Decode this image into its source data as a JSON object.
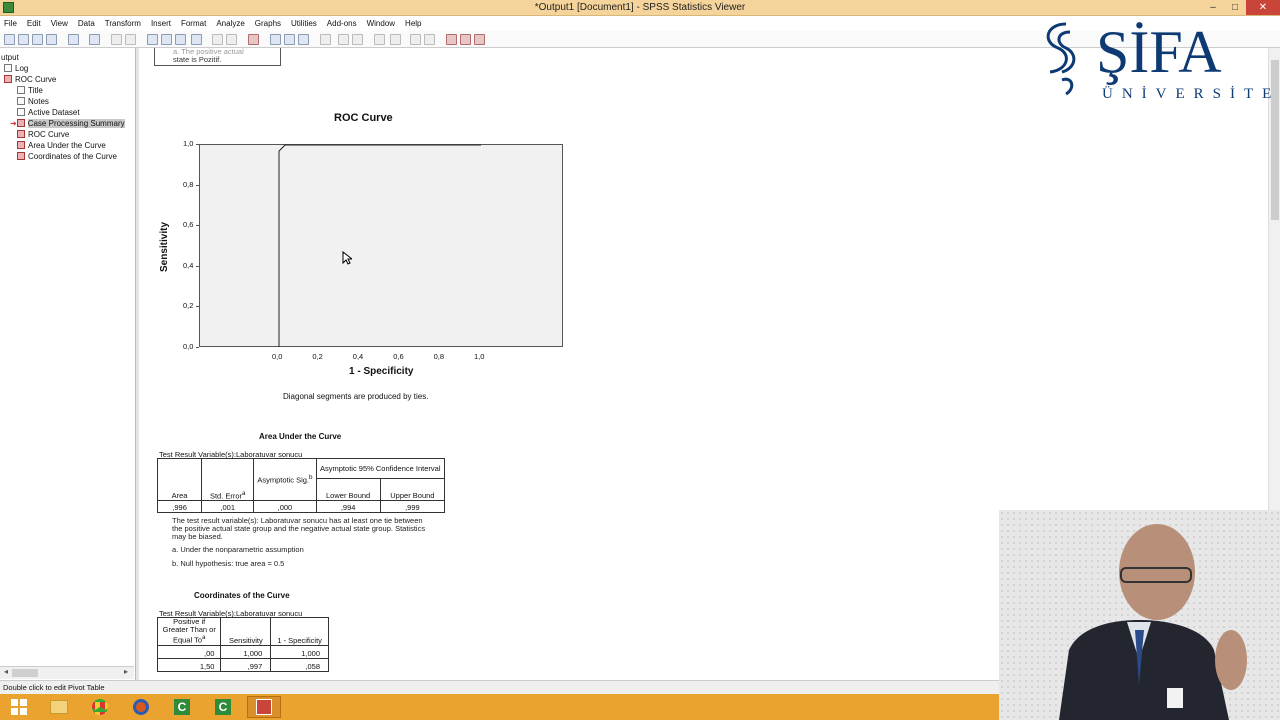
{
  "window": {
    "title": "*Output1 [Document1] - SPSS Statistics Viewer",
    "minimize": "–",
    "maximize": "□",
    "close": "✕"
  },
  "menu": [
    "File",
    "Edit",
    "View",
    "Data",
    "Transform",
    "Insert",
    "Format",
    "Analyze",
    "Graphs",
    "Utilities",
    "Add-ons",
    "Window",
    "Help"
  ],
  "outline": {
    "items": [
      {
        "label": "utput",
        "icon": "none",
        "selected": false
      },
      {
        "label": "Log",
        "icon": "log-icon",
        "selected": false
      },
      {
        "label": "ROC Curve",
        "icon": "folder-icon",
        "selected": false
      },
      {
        "label": "Title",
        "icon": "doc-icon",
        "selected": false
      },
      {
        "label": "Notes",
        "icon": "doc-icon",
        "selected": false
      },
      {
        "label": "Active Dataset",
        "icon": "doc-icon",
        "selected": false
      },
      {
        "label": "Case Processing Summary",
        "icon": "table-icon",
        "selected": true
      },
      {
        "label": "ROC Curve",
        "icon": "chart-icon",
        "selected": false
      },
      {
        "label": "Area Under the Curve",
        "icon": "table-icon",
        "selected": false
      },
      {
        "label": "Coordinates of the Curve",
        "icon": "table-icon",
        "selected": false
      }
    ]
  },
  "content": {
    "note_fragment": [
      "a. The positive actual",
      "state is Pozitif."
    ],
    "roc_chart": {
      "chart_data": {
        "type": "line",
        "title": "ROC Curve",
        "xlabel": "1 - Specificity",
        "ylabel": "Sensitivity",
        "x_ticks": [
          "0,0",
          "0,2",
          "0,4",
          "0,6",
          "0,8",
          "1,0"
        ],
        "y_ticks": [
          "0,0",
          "0,2",
          "0,4",
          "0,6",
          "0,8",
          "1,0"
        ],
        "xlim": [
          0,
          1
        ],
        "ylim": [
          0,
          1
        ],
        "series": [
          {
            "x": [
              0.0,
              0.0,
              0.03,
              1.0
            ],
            "y": [
              0.0,
              0.97,
              1.0,
              1.0
            ]
          }
        ],
        "grid": false
      },
      "note": "Diagonal segments are produced by ties."
    },
    "auc_table": {
      "title": "Area Under the Curve",
      "variable": "Test Result Variable(s):Laboratuvar sonucu",
      "group_header": "Asymptotic 95% Confidence Interval",
      "headers": [
        "Area",
        "Std. Error",
        "Asymptotic Sig.",
        "Lower Bound",
        "Upper Bound"
      ],
      "header_sup": {
        "std": "a",
        "sig": "b"
      },
      "row": [
        ",996",
        ",001",
        ",000",
        ",994",
        ",999"
      ],
      "footnotes": [
        "The test result variable(s): Laboratuvar sonucu has at least one tie between the positive actual state group and the negative actual state group. Statistics may be biased.",
        "a. Under the nonparametric assumption",
        "b. Null hypothesis: true area = 0.5"
      ]
    },
    "coords_table": {
      "title": "Coordinates of the Curve",
      "variable": "Test Result Variable(s):Laboratuvar sonucu",
      "headers": [
        "Positive if Greater Than or Equal To",
        "Sensitivity",
        "1 - Specificity"
      ],
      "header_sup": "a",
      "rows": [
        [
          ",00",
          "1,000",
          "1,000"
        ],
        [
          "1,50",
          ",997",
          ",058"
        ]
      ]
    }
  },
  "status": "Double click to edit Pivot Table",
  "logo": {
    "main": "ŞİFA",
    "sub": "ÜNİVERSİTESİ"
  },
  "colors": {
    "titlebar": "#f4d49a",
    "taskbar": "#e9a32e",
    "selected": "#c9c9c9",
    "logo": "#0e3a74"
  }
}
